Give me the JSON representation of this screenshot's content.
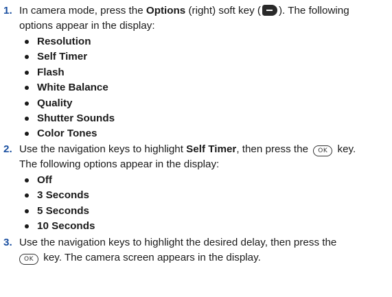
{
  "steps": [
    {
      "number": "1.",
      "line1_a": "In camera mode, press the ",
      "line1_bold": "Options",
      "line1_b": " (right) soft key (",
      "line1_c": "). The following",
      "line2": "options appear in the display:",
      "icon": "right-soft-key-icon",
      "bullets": [
        "Resolution",
        "Self Timer",
        "Flash",
        "White Balance",
        "Quality",
        "Shutter Sounds",
        "Color Tones"
      ]
    },
    {
      "number": "2.",
      "line1_a": "Use the navigation keys to highlight ",
      "line1_bold": "Self Timer",
      "line1_b": ", then press the ",
      "line1_c": " key.",
      "line2": "The following options appear in the display:",
      "ok_key_label": "OK",
      "bullets": [
        "Off",
        "3 Seconds",
        "5 Seconds",
        "10 Seconds"
      ]
    },
    {
      "number": "3.",
      "line1": "Use the navigation keys to highlight the desired delay, then press the",
      "line2_b": " key. The camera screen appears in the display.",
      "ok_key_label": "OK"
    }
  ],
  "colors": {
    "step_number": "#1a4fa0",
    "text": "#1a1a1a"
  }
}
